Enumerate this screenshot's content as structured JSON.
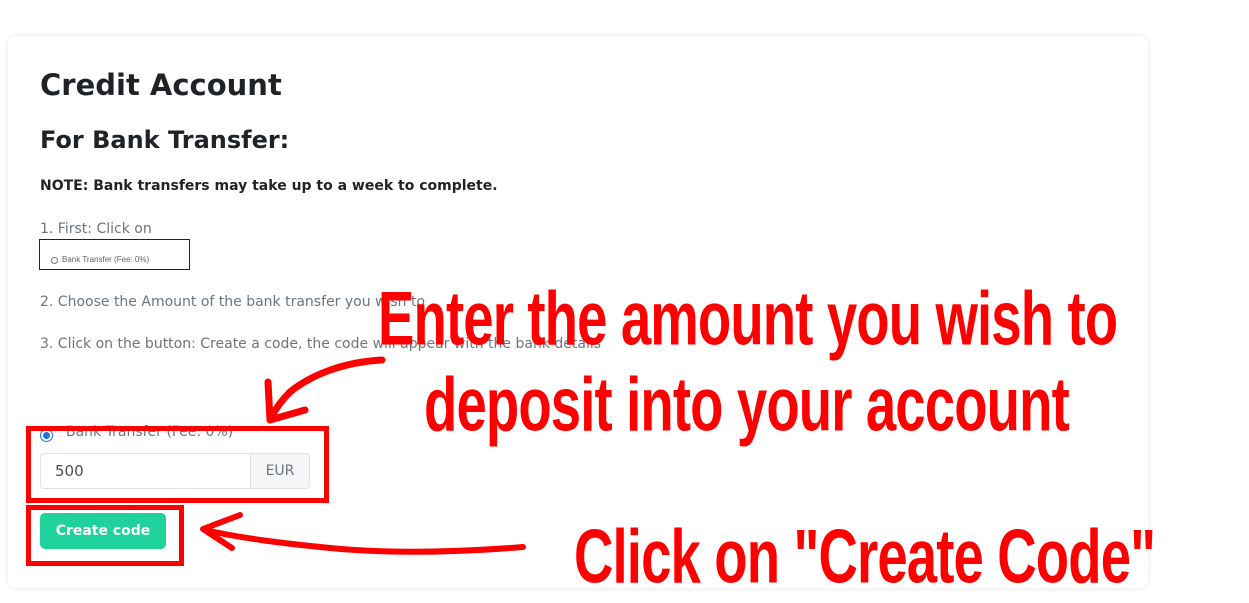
{
  "card": {
    "title": "Credit Account",
    "section_title": "For Bank Transfer:",
    "note": "NOTE: Bank transfers may take up to a week to complete.",
    "steps": {
      "step1": "1. First: Click on",
      "step2": "2. Choose the Amount of the bank transfer you wish to",
      "step3": "3. Click on the button: Create a code, the code will appear with the bank details"
    },
    "mini_screenshot": {
      "label": "Bank Transfer (Fee: 0%)"
    },
    "payment_option": {
      "label": "Bank Transfer (Fee: 0%)",
      "selected": true
    },
    "amount": {
      "value": "500",
      "currency": "EUR"
    },
    "create_button_label": "Create code"
  },
  "annotations": {
    "line1": "Enter the amount you wish to",
    "line2": "deposit into your account",
    "click": "Click on \"Create Code\""
  },
  "colors": {
    "accent": "#1fd19b",
    "annotation": "#ff0000",
    "radio": "#1a73e8"
  }
}
